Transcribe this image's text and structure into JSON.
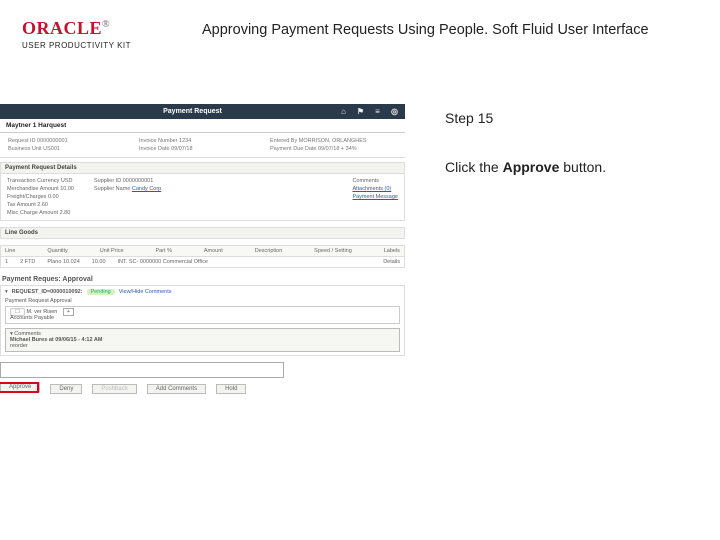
{
  "header": {
    "brand1": "ORACLE",
    "brand_reg": "®",
    "brand2": "USER PRODUCTIVITY KIT",
    "title": "Approving Payment Requests Using People. Soft Fluid User Interface"
  },
  "instructions": {
    "step": "Step 15",
    "line_pre": "Click the ",
    "bold": "Approve",
    "line_post": " button."
  },
  "app": {
    "titlebar": {
      "left": "",
      "title": "Payment Request"
    },
    "tabs": [
      "Maytner 1 Harquest"
    ],
    "info": {
      "request_id": "Request ID  0000000001",
      "invoice_number": "Invoice Number  1234",
      "entered_by": "Entered By  MORRISON, ORLANGHES",
      "business_unit": "Business Unit  US001",
      "invoice_date": "Invoice Date  09/07/18",
      "payment_due_date": "Payment Due Date  09/07/18 + 34%"
    },
    "section_details": "Payment Request Details",
    "details": {
      "trans_currency": "Transaction Currency  USD",
      "merch_amount": "Merchandise Amount  10.00",
      "freight": "Freight/Charges  0.00",
      "tax": "Tax Amount  2.60",
      "misc": "Misc Charge Amount  2.80",
      "supplier_id": "Supplier ID  0000000001",
      "supplier_name_label": "Supplier Name",
      "supplier_name": "Candy Corp",
      "comments": "Comments",
      "attachments": "Attachments (0)",
      "payment_message": "Payment Message"
    },
    "line_goods": {
      "header": "Line Goods",
      "cols": [
        "Line",
        "Quantity",
        "Unit Price",
        "Part %",
        "Amount",
        "Description",
        "Speed / Setting",
        "Labels"
      ],
      "row": [
        "1",
        "2 FTD",
        "Plano 10.024",
        "",
        "10.00",
        "INT. SC- 0000000 Commercial Office",
        "",
        "Details"
      ]
    },
    "approval": {
      "header": "Payment Reques: Approval",
      "req_line": "REQUEST_ID=0000010092:",
      "pending": "Pending",
      "viewhide": "View/Hide Comments",
      "subtext": "Payment Request Approval",
      "approver_name": "M. ver Risen",
      "approver_role": "Accounts Payable",
      "plus": "+",
      "history_hdr": "Comments",
      "history_line1": "Michael Bures at 09/06/15 - 4:12 AM",
      "history_line2": "reorder"
    },
    "buttons": {
      "approve": "Approve",
      "deny": "Deny",
      "pushback": "Pushback",
      "addcomments": "Add Comments",
      "hold": "Hold"
    }
  }
}
